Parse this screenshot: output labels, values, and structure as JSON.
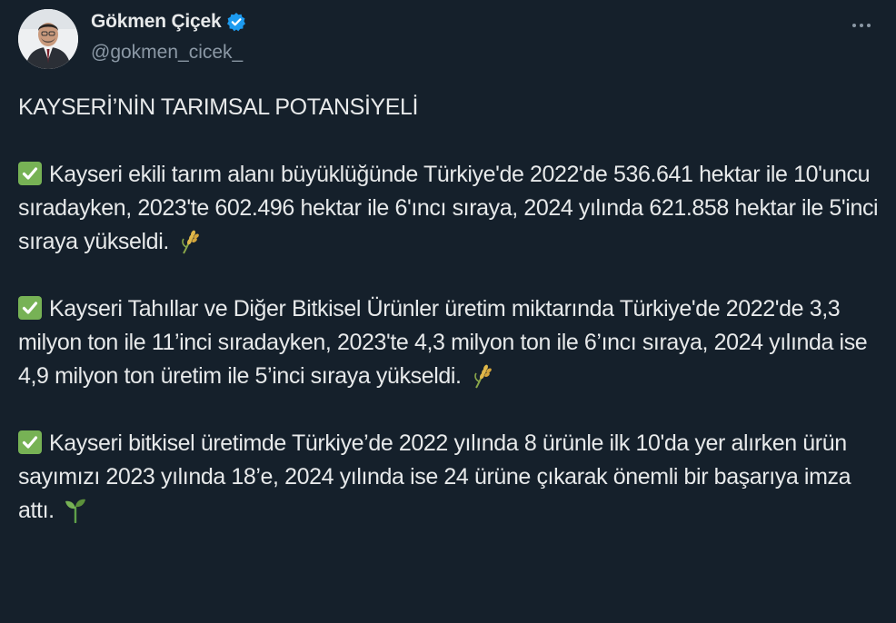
{
  "author": {
    "display_name": "Gökmen Çiçek",
    "handle": "@gokmen_cicek_",
    "verified": true
  },
  "colors": {
    "background": "#15202b",
    "text": "#e7e9ea",
    "secondary_text": "#8b98a5",
    "verified_blue": "#1d9bf0",
    "check_green": "#77b255"
  },
  "icons": {
    "verified": "verified-badge-icon",
    "more": "more-options-icon",
    "check": "check-mark-button-emoji",
    "rice": "sheaf-of-rice-emoji",
    "seedling": "seedling-emoji"
  },
  "tweet": {
    "title": "KAYSERİ’NİN TARIMSAL POTANSİYELİ",
    "paragraphs": [
      {
        "text": "Kayseri ekili tarım alanı büyüklüğünde Türkiye'de 2022'de 536.641 hektar ile 10'uncu sıradayken, 2023'te 602.496 hektar ile 6'ıncı sıraya, 2024 yılında 621.858 hektar ile 5'inci sıraya yükseldi.",
        "end_emoji": "sheaf-of-rice-emoji"
      },
      {
        "text": "Kayseri Tahıllar ve Diğer Bitkisel Ürünler üretim miktarında Türkiye'de 2022'de 3,3 milyon ton ile 11’inci sıradayken, 2023'te 4,3 milyon ton ile 6’ıncı sıraya, 2024 yılında ise 4,9 milyon ton üretim ile 5’inci sıraya yükseldi.",
        "end_emoji": "sheaf-of-rice-emoji"
      },
      {
        "text": "Kayseri bitkisel üretimde Türkiye’de 2022 yılında 8 ürünle ilk 10'da yer alırken ürün sayımızı 2023 yılında 18’e, 2024 yılında ise 24 ürüne çıkarak önemli bir başarıya imza attı.",
        "end_emoji": "seedling-emoji"
      }
    ]
  }
}
